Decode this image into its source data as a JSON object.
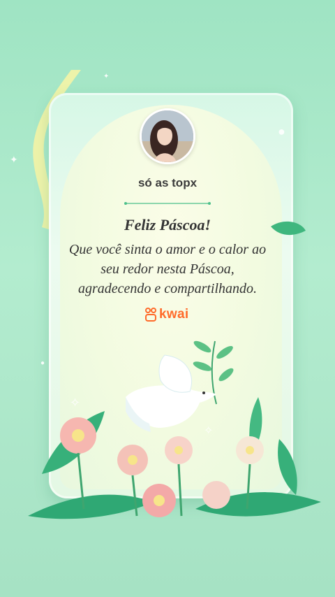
{
  "profile": {
    "username": "só as topx"
  },
  "card": {
    "title": "Feliz Páscoa!",
    "message_lines": [
      "Que você sinta o amor e o calor ao",
      "seu redor nesta Páscoa,",
      "agradecendo e compartilhando."
    ]
  },
  "brand": {
    "name": "kwai",
    "color": "#ff6a2a"
  },
  "colors": {
    "background": "#a6e4c6",
    "card": "#e4f8e4",
    "accent_green": "#3fb67e"
  },
  "icons": [
    "kwai-logo-icon",
    "dove-illustration",
    "flower-illustration",
    "sparkle-icon"
  ]
}
